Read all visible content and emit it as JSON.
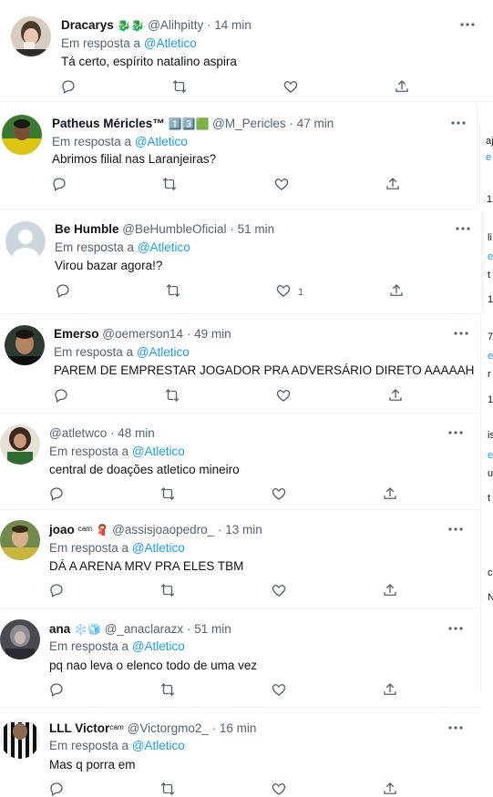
{
  "tweets": [
    {
      "name": "Dracarys",
      "badge": "🐉🐉",
      "handle": "@Alihpitty",
      "sep": "·",
      "time": "14 min",
      "reply_prefix": "Em resposta a",
      "reply_to": "@Atletico",
      "text": "Tá certo, espírito natalino aspira",
      "like_count": ""
    },
    {
      "name": "Patheus Méricles™",
      "badge": "1️⃣3️⃣🟩",
      "handle": "@M_Pericles",
      "sep": "·",
      "time": "47 min",
      "reply_prefix": "Em resposta a",
      "reply_to": "@Atletico",
      "text": "Abrimos filial nas Laranjeiras?",
      "like_count": ""
    },
    {
      "name": "Be Humble",
      "badge": "",
      "handle": "@BeHumbleOficial",
      "sep": "·",
      "time": "51 min",
      "reply_prefix": "Em resposta a",
      "reply_to": "@Atletico",
      "text": "Virou bazar agora!?",
      "like_count": "1"
    },
    {
      "name": "Emerso",
      "badge": "",
      "handle": "@oemerson14",
      "sep": "·",
      "time": "49 min",
      "reply_prefix": "Em resposta a",
      "reply_to": "@Atletico",
      "text": "PAREM DE EMPRESTAR JOGADOR PRA ADVERSÁRIO DIRETO AAAAAH",
      "like_count": ""
    },
    {
      "name": "",
      "badge": "",
      "handle": "@atletwco",
      "sep": "·",
      "time": "48 min",
      "reply_prefix": "Em resposta a",
      "reply_to": "@Atletico",
      "text": "central de doações atletico mineiro",
      "like_count": ""
    },
    {
      "name": "joao",
      "badge": "ᶜᵃᵐ 🧣",
      "handle": "@assisjoaopedro_",
      "sep": "·",
      "time": "13 min",
      "reply_prefix": "Em resposta a",
      "reply_to": "@Atletico",
      "text": "DÁ A ARENA MRV PRA ELES TBM",
      "like_count": ""
    },
    {
      "name": "ana",
      "badge": "❄️🧊",
      "handle": "@_anaclarazx",
      "sep": "·",
      "time": "51 min",
      "reply_prefix": "Em resposta a",
      "reply_to": "@Atletico",
      "text": "pq nao leva o elenco todo de uma vez",
      "like_count": ""
    },
    {
      "name": "LLL Victor",
      "badge": "ᶜᵃᵐ",
      "handle": "@Victorgmo2_",
      "sep": "·",
      "time": "16 min",
      "reply_prefix": "Em resposta a",
      "reply_to": "@Atletico",
      "text": "Mas q porra em",
      "like_count": ""
    }
  ],
  "sidebar_fragments": [
    "aj",
    "e",
    "1",
    "li",
    "e",
    "t",
    "1",
    "7",
    "e",
    "r",
    "1",
    "is",
    "e",
    "u",
    "t",
    "c",
    "N"
  ],
  "colors": {
    "accent": "#1d9bf0",
    "secondary_text": "#536471",
    "border": "#eff3f4"
  }
}
